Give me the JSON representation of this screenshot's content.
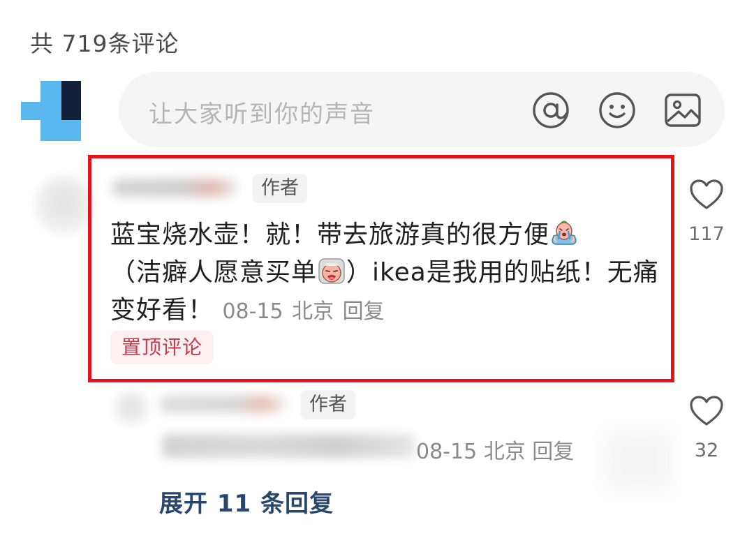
{
  "header": {
    "total_count": "共 719条评论"
  },
  "composer": {
    "placeholder": "让大家听到你的声音",
    "icons": [
      "at-icon",
      "emoji-icon",
      "image-icon"
    ]
  },
  "comments": [
    {
      "author_tag": "作者",
      "text_part1": "蓝宝烧水壶！就！带去旅游真的很方便",
      "text_part2": "（洁癖人愿意买单",
      "text_part3": "）ikea是我用的贴纸！无痛变好看！",
      "date": "08-15",
      "location": "北京",
      "reply_label": "回复",
      "pinned_label": "置顶评论",
      "like_count": "117",
      "emojis": [
        "crying-emoji",
        "sob-emoji"
      ]
    },
    {
      "author_tag": "作者",
      "date": "08-15",
      "location": "北京",
      "reply_label": "回复",
      "like_count": "32"
    }
  ],
  "expand": {
    "label": "展开 11 条回复"
  },
  "colors": {
    "highlight_border": "#e4121b",
    "pinned_text": "#c53a4a",
    "pinned_bg": "#fdf0f1",
    "expand_text": "#27476e",
    "self_avatar_light": "#5bb8ee",
    "self_avatar_dark": "#13203a"
  }
}
